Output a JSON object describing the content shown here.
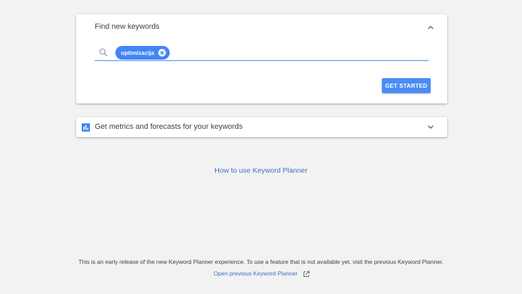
{
  "find_card": {
    "title": "Find new keywords",
    "collapse_icon": "chevron-up-icon",
    "search_icon": "search-icon",
    "chip_label": "optimizacija",
    "chip_remove_icon": "close-circle-icon",
    "get_started_label": "GET STARTED"
  },
  "metrics_card": {
    "icon": "bar-chart-icon",
    "title": "Get metrics and forecasts for your keywords",
    "expand_icon": "chevron-down-icon"
  },
  "links": {
    "how_to": "How to use Keyword Planner"
  },
  "footer": {
    "notice": "This is an early release of the new Keyword Planner experience. To use a feature that is not available yet, visit the previous Keyword Planner.",
    "open_previous": "Open previous Keyword Planner",
    "open_previous_icon": "external-link-icon"
  },
  "colors": {
    "accent": "#4285f4",
    "link": "#3f6fc3",
    "background": "#f2f2f2"
  }
}
